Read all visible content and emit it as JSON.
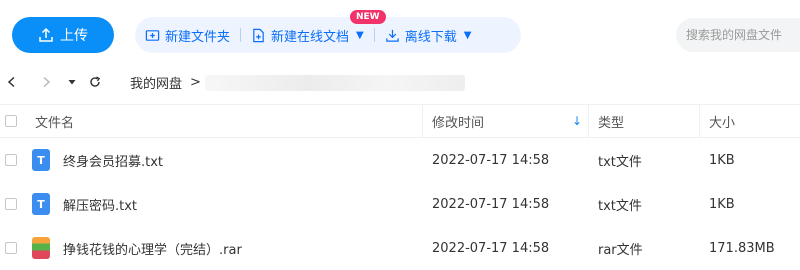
{
  "toolbar": {
    "upload_label": "上传",
    "new_folder_label": "新建文件夹",
    "new_online_doc_label": "新建在线文档",
    "new_badge": "NEW",
    "offline_download_label": "离线下载",
    "search_placeholder": "搜索我的网盘文件"
  },
  "breadcrumb": {
    "root": "我的网盘",
    "separator": ">"
  },
  "table": {
    "columns": {
      "name": "文件名",
      "modified": "修改时间",
      "type": "类型",
      "size": "大小"
    },
    "rows": [
      {
        "icon": "T",
        "icon_type": "txt-file-icon",
        "name": "终身会员招募.txt",
        "modified": "2022-07-17 14:58",
        "type": "txt文件",
        "size": "1KB"
      },
      {
        "icon": "T",
        "icon_type": "txt-file-icon",
        "name": "解压密码.txt",
        "modified": "2022-07-17 14:58",
        "type": "txt文件",
        "size": "1KB"
      },
      {
        "icon": "",
        "icon_type": "rar-file-icon",
        "name": "挣钱花钱的心理学（完结）.rar",
        "modified": "2022-07-17 14:58",
        "type": "rar文件",
        "size": "171.83MB"
      }
    ]
  },
  "colors": {
    "accent": "#0a8ef8",
    "badge": "#f2336b",
    "action_bg": "#eef4ff"
  }
}
